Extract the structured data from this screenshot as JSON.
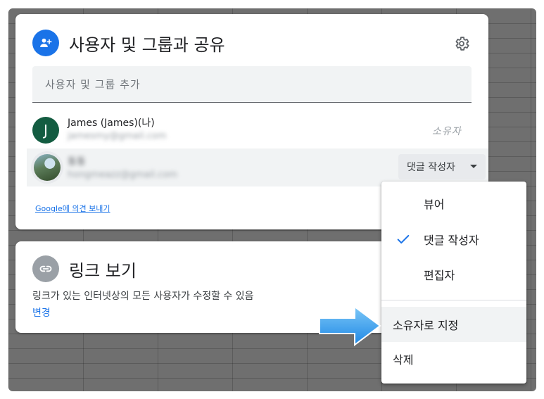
{
  "share": {
    "title": "사용자 및 그룹과 공유",
    "add_placeholder": "사용자 및 그룹 추가",
    "people": [
      {
        "name": "James (James)(나)",
        "email": "jamesmy@gmail.com",
        "initial": "J",
        "role": "소유자"
      },
      {
        "name": "동동",
        "email": "hongmeazz@gmail.com",
        "role": "댓글 작성자"
      }
    ],
    "feedback_link": "Google에 의견 보내기"
  },
  "link": {
    "title": "링크 보기",
    "description": "링크가 있는 인터넷상의 모든 사용자가 수정할 수 있음",
    "change": "변경"
  },
  "menu": {
    "items": [
      "뷰어",
      "댓글 작성자",
      "편집자"
    ],
    "selected": "댓글 작성자",
    "transfer_owner": "소유자로 지정",
    "remove": "삭제"
  },
  "colors": {
    "accent": "#1a73e8",
    "owner_avatar": "#135c41",
    "arrow": "#3aa3f0"
  },
  "icons": {
    "share": "person-add-icon",
    "settings": "gear-icon",
    "link": "link-icon",
    "check": "check-icon",
    "caret": "caret-down-icon",
    "pointer": "arrow-right-icon"
  }
}
